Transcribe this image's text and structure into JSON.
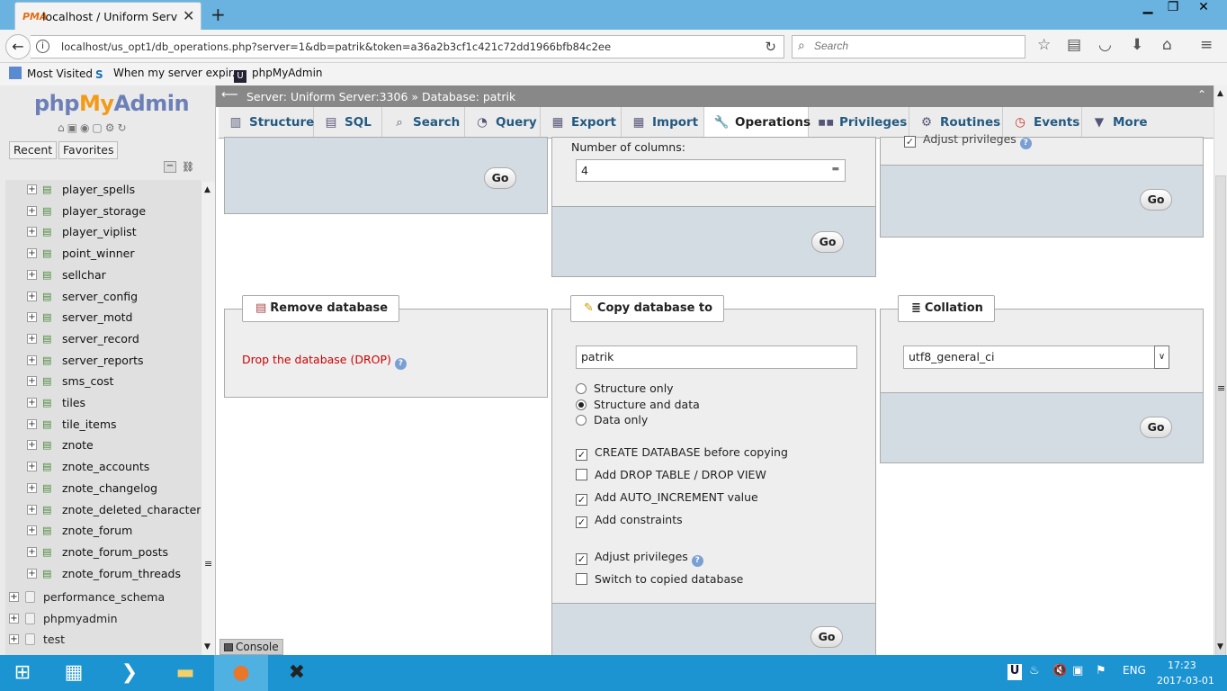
{
  "browser": {
    "tab_title": "localhost / Uniform Server...",
    "tab_favicon": "pma",
    "url": "localhost/us_opt1/db_operations.php?server=1&db=patrik&token=a36a2b3cf1c421c72dd1966bfb84c2ee",
    "search_placeholder": "Search",
    "bookmarks": [
      "Most Visited",
      "When my server expir...",
      "phpMyAdmin"
    ]
  },
  "sidebar": {
    "logo": {
      "php": "php",
      "my": "My",
      "admin": "Admin"
    },
    "buttons": [
      "Recent",
      "Favorites"
    ],
    "tables": [
      "player_spells",
      "player_storage",
      "player_viplist",
      "point_winner",
      "sellchar",
      "server_config",
      "server_motd",
      "server_record",
      "server_reports",
      "sms_cost",
      "tiles",
      "tile_items",
      "znote",
      "znote_accounts",
      "znote_changelog",
      "znote_deleted_characters",
      "znote_forum",
      "znote_forum_posts",
      "znote_forum_threads"
    ],
    "databases": [
      "performance_schema",
      "phpmyadmin",
      "test"
    ]
  },
  "breadcrumb": {
    "server": "Server: Uniform Server:3306",
    "database": "Database: patrik"
  },
  "menu": [
    "Structure",
    "SQL",
    "Search",
    "Query",
    "Export",
    "Import",
    "Operations",
    "Privileges",
    "Routines",
    "Events",
    "More"
  ],
  "top_partial": {
    "columns_label": "Number of columns:",
    "columns_value": "4",
    "adjust_privileges_text": "Adjust privileges"
  },
  "go_label": "Go",
  "remove_db": {
    "legend": "Remove database",
    "drop_link": "Drop the database (DROP)"
  },
  "copy_db": {
    "legend": "Copy database to",
    "name_value": "patrik",
    "radios": [
      {
        "label": "Structure only",
        "checked": false
      },
      {
        "label": "Structure and data",
        "checked": true
      },
      {
        "label": "Data only",
        "checked": false
      }
    ],
    "checkboxes": [
      {
        "label": "CREATE DATABASE before copying",
        "checked": true
      },
      {
        "label": "Add DROP TABLE / DROP VIEW",
        "checked": false
      },
      {
        "label": "Add AUTO_INCREMENT value",
        "checked": true
      },
      {
        "label": "Add constraints",
        "checked": true
      },
      {
        "label": "Adjust privileges",
        "checked": true
      },
      {
        "label": "Switch to copied database",
        "checked": false
      }
    ]
  },
  "collation": {
    "legend": "Collation",
    "value": "utf8_general_ci"
  },
  "console_label": "Console",
  "taskbar": {
    "lang": "ENG",
    "time": "17:23",
    "date": "2017-03-01"
  }
}
